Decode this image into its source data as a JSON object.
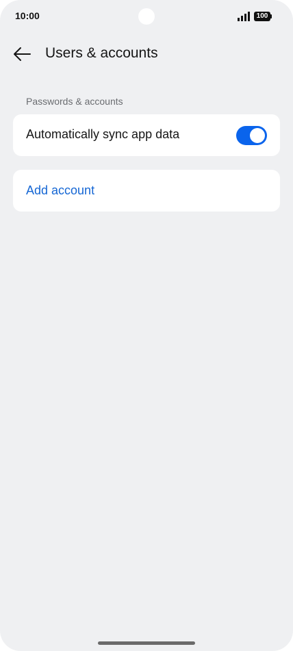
{
  "status_bar": {
    "time": "10:00",
    "battery_level": "100",
    "signal_icon": "signal-bars-icon",
    "battery_icon": "battery-icon"
  },
  "header": {
    "back_icon": "arrow-left-icon",
    "title": "Users & accounts"
  },
  "section": {
    "label": "Passwords & accounts",
    "items": [
      {
        "label": "Automatically sync app data",
        "toggle_on": true
      }
    ]
  },
  "actions": {
    "add_account_label": "Add account"
  },
  "colors": {
    "background": "#eff0f2",
    "card": "#ffffff",
    "accent": "#0a64ec",
    "link": "#1466d4"
  }
}
